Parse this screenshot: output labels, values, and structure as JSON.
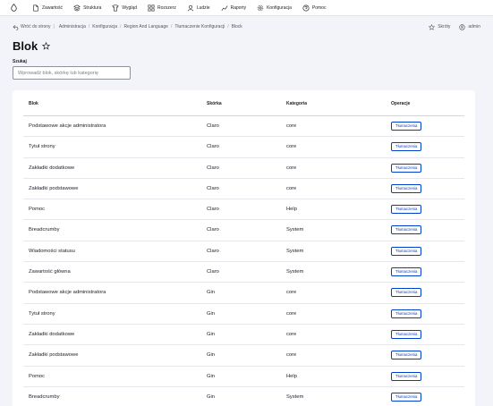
{
  "toolbar": {
    "items": [
      {
        "label": "Zawartość",
        "icon": "file-icon"
      },
      {
        "label": "Struktura",
        "icon": "structure-icon"
      },
      {
        "label": "Wygląd",
        "icon": "appearance-icon"
      },
      {
        "label": "Rozszerz",
        "icon": "extend-icon"
      },
      {
        "label": "Ludzie",
        "icon": "people-icon"
      },
      {
        "label": "Raporty",
        "icon": "reports-icon"
      },
      {
        "label": "Konfiguracja",
        "icon": "gear-icon"
      },
      {
        "label": "Pomoc",
        "icon": "help-icon"
      }
    ]
  },
  "secondary": {
    "back_label": "Wróć do strony",
    "breadcrumbs": [
      "Administracja",
      "Konfiguracja",
      "Region And Language",
      "Tłumaczenie Konfiguracji",
      "Block"
    ],
    "shortcuts_label": "Skróty",
    "user_label": "admin"
  },
  "page": {
    "title": "Blok"
  },
  "search": {
    "label": "Szukaj",
    "placeholder": "Wprowadź blok, skórkę lub kategorię"
  },
  "table": {
    "headers": [
      "Blok",
      "Skórka",
      "Kategoria",
      "Operacje"
    ],
    "button_label": "Tłumaczenia",
    "rows": [
      [
        "Podstawowe akcje administratora",
        "Claro",
        "core"
      ],
      [
        "Tytuł strony",
        "Claro",
        "core"
      ],
      [
        "Zakładki dodatkowe",
        "Claro",
        "core"
      ],
      [
        "Zakładki podstawowe",
        "Claro",
        "core"
      ],
      [
        "Pomoc",
        "Claro",
        "Help"
      ],
      [
        "Breadcrumby",
        "Claro",
        "System"
      ],
      [
        "Wiadomości statusu",
        "Claro",
        "System"
      ],
      [
        "Zawartość główna",
        "Claro",
        "System"
      ],
      [
        "Podstawowe akcje administratora",
        "Gin",
        "core"
      ],
      [
        "Tytuł strony",
        "Gin",
        "core"
      ],
      [
        "Zakładki dodatkowe",
        "Gin",
        "core"
      ],
      [
        "Zakładki podstawowe",
        "Gin",
        "core"
      ],
      [
        "Pomoc",
        "Gin",
        "Help"
      ],
      [
        "Breadcrumby",
        "Gin",
        "System"
      ]
    ]
  },
  "colors": {
    "accent": "#003ecc",
    "background": "#f3f4f9"
  }
}
